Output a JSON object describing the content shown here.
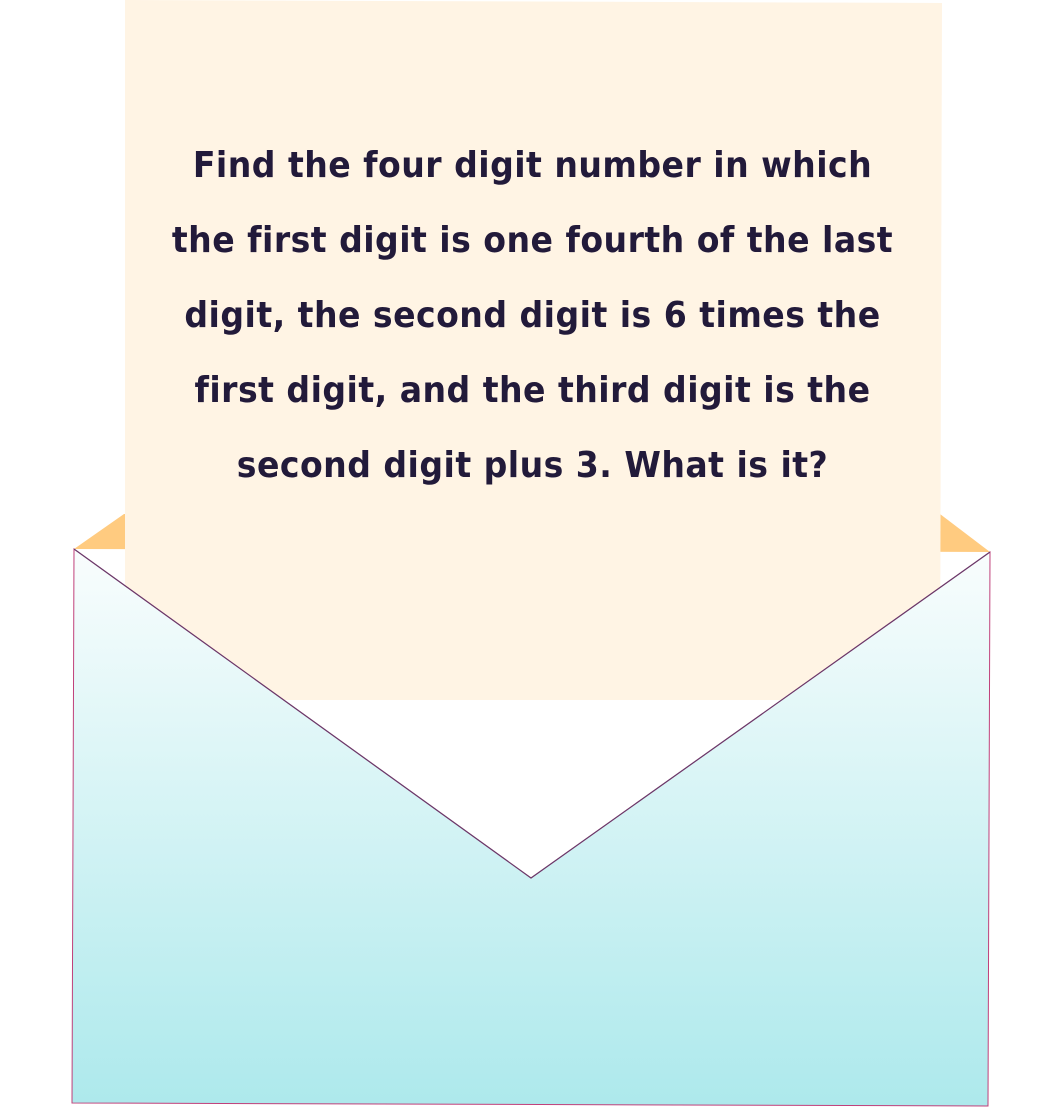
{
  "puzzle": {
    "question": "Find the four digit number in which the first digit is one fourth of the last digit, the second digit is 6 times the first digit, and the third digit is the second digit plus 3. What is it?"
  },
  "colors": {
    "paper": "#fff4e4",
    "envelope_inner_flap": "#ffcb80",
    "envelope_top": "#f9fdfd",
    "envelope_bottom": "#ade9ec",
    "envelope_edge": "#c0407a",
    "text": "#221a3a"
  }
}
